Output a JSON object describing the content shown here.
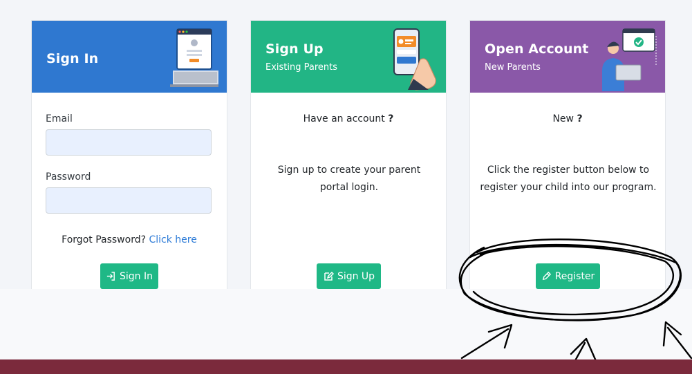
{
  "colors": {
    "signin_header": "#2f78d0",
    "signup_header": "#22b585",
    "open_header": "#8a58a8",
    "button": "#1fb886",
    "link": "#2d7bd7",
    "footer": "#7b2a3c"
  },
  "signin": {
    "title": "Sign In",
    "email_label": "Email",
    "email_value": "",
    "password_label": "Password",
    "password_value": "",
    "forgot_text": "Forgot Password?",
    "forgot_link": "Click here",
    "button_label": "Sign In",
    "button_icon": "sign-in-icon"
  },
  "signup": {
    "title": "Sign Up",
    "subtitle": "Existing Parents",
    "question": "Have an account",
    "question_mark": "?",
    "description": "Sign up to create your parent portal login.",
    "button_label": "Sign Up",
    "button_icon": "edit-icon"
  },
  "open_account": {
    "title": "Open Account",
    "subtitle": "New Parents",
    "question": "New",
    "question_mark": "?",
    "description": "Click the register button below to register your child into our program.",
    "button_label": "Register",
    "button_icon": "pencil-icon"
  }
}
